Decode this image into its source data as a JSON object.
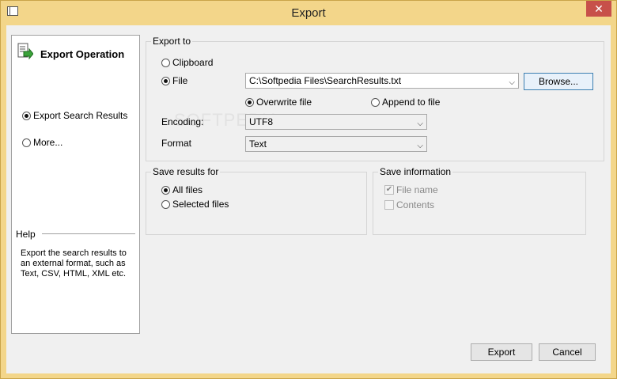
{
  "window": {
    "title": "Export",
    "close_glyph": "✕"
  },
  "left_panel": {
    "title": "Export Operation",
    "options": [
      {
        "label": "Export Search Results",
        "checked": true
      },
      {
        "label": "More...",
        "checked": false
      }
    ],
    "help_label": "Help",
    "help_text": "Export the search results to an external format, such as Text, CSV, HTML, XML etc."
  },
  "export_to": {
    "group_label": "Export to",
    "clipboard_label": "Clipboard",
    "file_label": "File",
    "file_path": "C:\\Softpedia Files\\SearchResults.txt",
    "browse_label": "Browse...",
    "overwrite_label": "Overwrite file",
    "append_label": "Append to file",
    "encoding_label": "Encoding:",
    "encoding_value": "UTF8",
    "format_label": "Format",
    "format_value": "Text"
  },
  "save_results_for": {
    "group_label": "Save results for",
    "all_label": "All files",
    "selected_label": "Selected files"
  },
  "save_information": {
    "group_label": "Save information",
    "file_name_label": "File name",
    "contents_label": "Contents"
  },
  "buttons": {
    "export": "Export",
    "cancel": "Cancel"
  },
  "watermark": "SOFTPEDIA",
  "colors": {
    "frame": "#f3d68a",
    "close": "#c7504a",
    "focus": "#3c7fb1"
  }
}
